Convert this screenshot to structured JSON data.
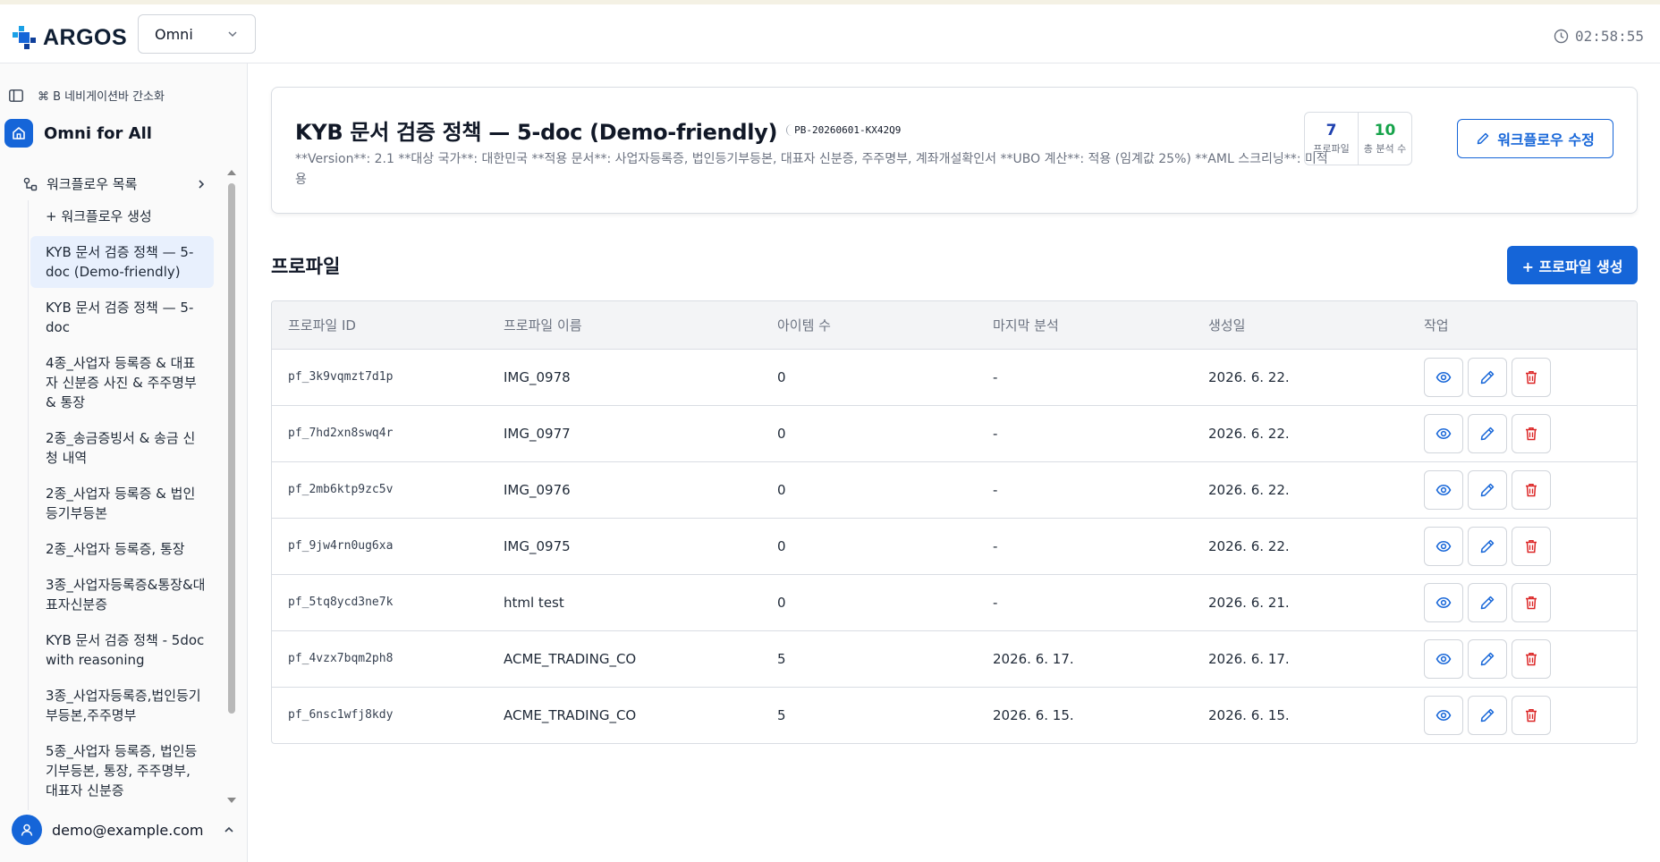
{
  "app": {
    "brand": "ARGOS",
    "workspace": "Omni",
    "clock": "02:58:55"
  },
  "colors": {
    "primary": "#1565d8",
    "success": "#16a34a",
    "danger": "#dc2626"
  },
  "sidebar": {
    "toggle_label": "⌘ B 네비게이션바 간소화",
    "home_label": "Omni for All",
    "workflow_header": "워크플로우 목록",
    "create_label": "+ 워크플로우 생성",
    "items": [
      "KYB 문서 검증 정책 — 5-doc (Demo-friendly)",
      "KYB 문서 검증 정책 — 5-doc",
      "4종_사업자 등록증 & 대표자 신분증 사진 & 주주명부 & 통장",
      "2종_송금증빙서 & 송금 신청 내역",
      "2종_사업자 등록증 & 법인등기부등본",
      "2종_사업자 등록증, 통장",
      "3종_사업자등록증&통장&대표자신분증",
      "KYB 문서 검증 정책 - 5doc with reasoning",
      "3종_사업자등록증,법인등기부등본,주주명부",
      "5종_사업자 등록증, 법인등기부등본, 통장, 주주명부, 대표자 신분증"
    ],
    "user_email": "demo@example.com"
  },
  "policy": {
    "title": "KYB 문서 검증 정책 — 5-doc (Demo-friendly)",
    "code": "PB-20260601-KX42Q9",
    "description": "**Version**: 2.1 **대상 국가**: 대한민국 **적용 문서**: 사업자등록증, 법인등기부등본, 대표자 신분증, 주주명부, 계좌개설확인서 **UBO 계산**: 적용 (임계값 25%) **AML 스크리닝**: 미적용",
    "stats": [
      {
        "value": "7",
        "label": "프로파일"
      },
      {
        "value": "10",
        "label": "총 분석 수"
      }
    ],
    "edit_label": "워크플로우 수정"
  },
  "profiles": {
    "title": "프로파일",
    "create_label": "+ 프로파일 생성",
    "columns": [
      "프로파일 ID",
      "프로파일 이름",
      "아이템 수",
      "마지막 분석",
      "생성일",
      "작업"
    ],
    "rows": [
      {
        "id": "pf_3k9vqmzt7d1p",
        "name": "IMG_0978",
        "items": "0",
        "last": "-",
        "created": "2026. 6. 22."
      },
      {
        "id": "pf_7hd2xn8swq4r",
        "name": "IMG_0977",
        "items": "0",
        "last": "-",
        "created": "2026. 6. 22."
      },
      {
        "id": "pf_2mb6ktp9zc5v",
        "name": "IMG_0976",
        "items": "0",
        "last": "-",
        "created": "2026. 6. 22."
      },
      {
        "id": "pf_9jw4rn0ug6xa",
        "name": "IMG_0975",
        "items": "0",
        "last": "-",
        "created": "2026. 6. 22."
      },
      {
        "id": "pf_5tq8ycd3ne7k",
        "name": "html test",
        "items": "0",
        "last": "-",
        "created": "2026. 6. 21."
      },
      {
        "id": "pf_4vzx7bqm2ph8",
        "name": "ACME_TRADING_CO",
        "items": "5",
        "last": "2026. 6. 17.",
        "created": "2026. 6. 17."
      },
      {
        "id": "pf_6nsc1wfj8kdy",
        "name": "ACME_TRADING_CO",
        "items": "5",
        "last": "2026. 6. 15.",
        "created": "2026. 6. 15."
      }
    ]
  }
}
